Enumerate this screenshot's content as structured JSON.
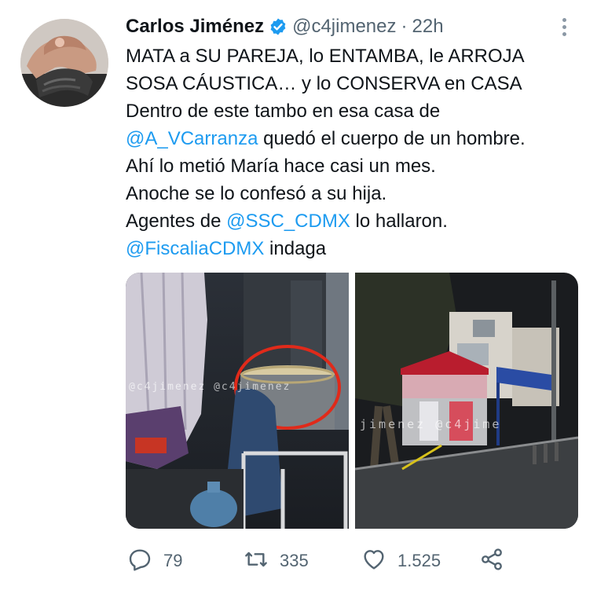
{
  "tweet": {
    "author_name": "Carlos Jiménez",
    "handle": "@c4jimenez",
    "separator": "·",
    "time": "22h",
    "lines": [
      [
        {
          "t": "text",
          "v": "MATA a SU PAREJA, lo ENTAMBA, le ARROJA"
        }
      ],
      [
        {
          "t": "text",
          "v": "SOSA CÁUSTICA… y lo CONSERVA en CASA"
        }
      ],
      [
        {
          "t": "text",
          "v": "Dentro de este tambo en esa casa de"
        }
      ],
      [
        {
          "t": "mention",
          "v": "@A_VCarranza"
        },
        {
          "t": "text",
          "v": " quedó el cuerpo de un hombre."
        }
      ],
      [
        {
          "t": "text",
          "v": "Ahí lo metió María hace casi un mes."
        }
      ],
      [
        {
          "t": "text",
          "v": "Anoche se lo confesó a su hija."
        }
      ],
      [
        {
          "t": "text",
          "v": "Agentes de "
        },
        {
          "t": "mention",
          "v": "@SSC_CDMX"
        },
        {
          "t": "text",
          "v": " lo hallaron."
        }
      ],
      [
        {
          "t": "mention",
          "v": "@FiscaliaCDMX"
        },
        {
          "t": "text",
          "v": " indaga"
        }
      ]
    ],
    "media": {
      "left_watermark": "@c4jimenez @c4jimenez",
      "right_watermark": "jimenez @c4jime"
    },
    "actions": {
      "reply_count": "79",
      "retweet_count": "335",
      "like_count": "1.525"
    }
  },
  "icons": {
    "verified": "verified-badge-icon",
    "more": "more-options-icon",
    "reply": "reply-icon",
    "retweet": "retweet-icon",
    "like": "heart-icon",
    "share": "share-icon"
  },
  "colors": {
    "mention": "#1d9bf0",
    "secondary_text": "#536471",
    "verified": "#1d9bf0",
    "icon_gray": "#536471"
  }
}
